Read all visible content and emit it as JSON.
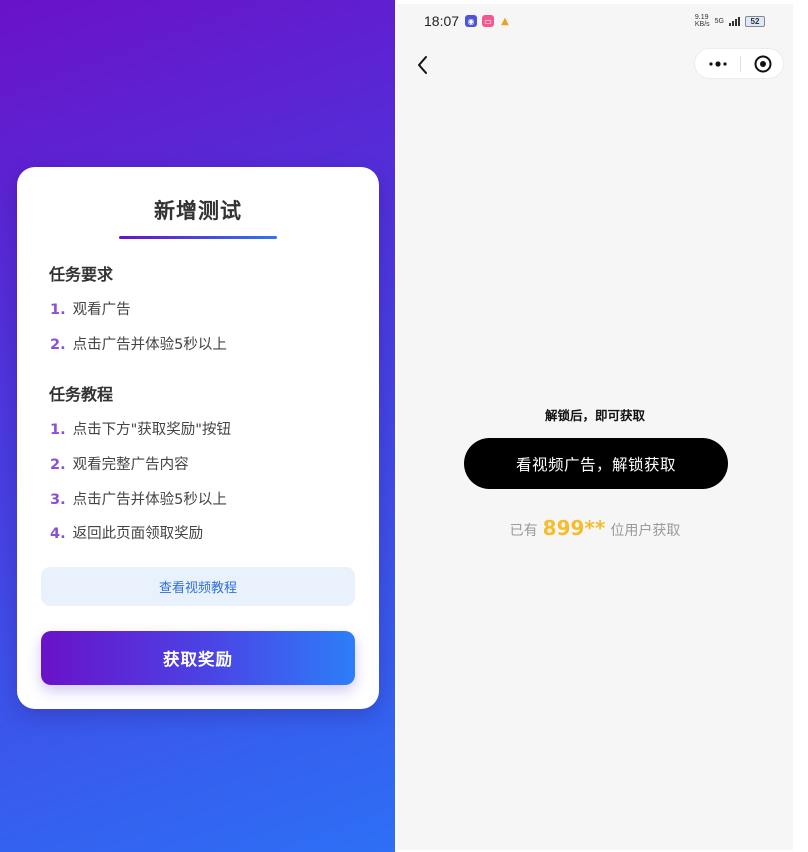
{
  "task_card": {
    "title": "新增测试",
    "requirements": {
      "heading": "任务要求",
      "items": [
        {
          "num": "1.",
          "text": "观看广告"
        },
        {
          "num": "2.",
          "text": "点击广告并体验5秒以上"
        }
      ]
    },
    "tutorial": {
      "heading": "任务教程",
      "items": [
        {
          "num": "1.",
          "text": "点击下方\"获取奖励\"按钮"
        },
        {
          "num": "2.",
          "text": "观看完整广告内容"
        },
        {
          "num": "3.",
          "text": "点击广告并体验5秒以上"
        },
        {
          "num": "4.",
          "text": "返回此页面领取奖励"
        }
      ]
    },
    "tutorial_button_label": "查看视频教程",
    "reward_button_label": "获取奖励"
  },
  "phone": {
    "status_bar": {
      "time": "18:07",
      "net_speed_value": "9.19",
      "net_speed_unit": "KB/s",
      "network": "5G",
      "battery": "52"
    },
    "unlock_hint": "解锁后，即可获取",
    "watch_button_label": "看视频广告，解锁获取",
    "user_count": {
      "prefix": "已有",
      "count": "899**",
      "suffix": "位用户获取"
    }
  },
  "colors": {
    "gradient_start": "#6a12c8",
    "gradient_end": "#2d6ff5",
    "count_highlight": "#f5bd2b",
    "step_number": "#8a4fd8"
  },
  "icons": [
    "back-arrow-icon",
    "more-dots-icon",
    "target-icon",
    "signal-icon",
    "battery-icon"
  ]
}
